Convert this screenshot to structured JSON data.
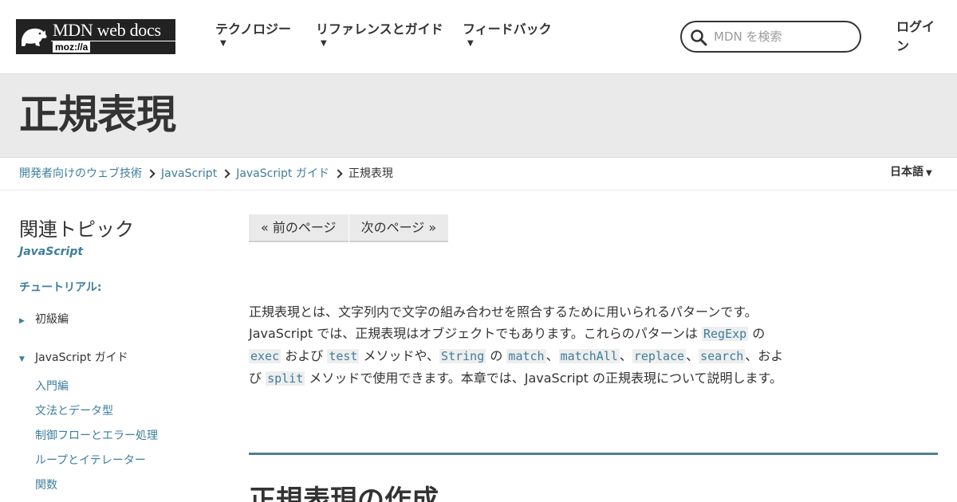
{
  "header": {
    "logo": {
      "title": "MDN web docs",
      "subtitle": "moz://a"
    },
    "nav": [
      {
        "label": "テクノロジー"
      },
      {
        "label": "リファレンスとガイド"
      },
      {
        "label": "フィードバック"
      }
    ],
    "search": {
      "placeholder": "MDN を検索",
      "value": ""
    },
    "login": "ログイン",
    "icons": {
      "logo": "mdn-dino-logo-icon",
      "search": "search-icon",
      "caret": "caret-down-icon"
    }
  },
  "page": {
    "title": "正規表現"
  },
  "breadcrumb": {
    "items": [
      {
        "label": "開発者向けのウェブ技術"
      },
      {
        "label": "JavaScript"
      },
      {
        "label": "JavaScript ガイド"
      }
    ],
    "current": "正規表現"
  },
  "language": {
    "label": "日本語"
  },
  "sidebar": {
    "heading": "関連トピック",
    "subheading": "JavaScript",
    "section": "チュートリアル:",
    "groups": [
      {
        "label": "初級編",
        "expanded": false
      },
      {
        "label": "JavaScript ガイド",
        "expanded": true
      }
    ],
    "links": [
      "入門編",
      "文法とデータ型",
      "制御フローとエラー処理",
      "ループとイテレーター",
      "関数"
    ]
  },
  "main": {
    "pager": {
      "prev": "« 前のページ",
      "next": "次のページ »"
    },
    "intro": {
      "t1": "正規表現とは、文字列内で文字の組み合わせを照合するために用いられるパターンです。JavaScript では、正規表現はオブジェクトでもあります。これらのパターンは ",
      "c1": "RegExp",
      "t2": " の ",
      "c2": "exec",
      "t3": " および ",
      "c3": "test",
      "t4": " メソッドや、",
      "c4": "String",
      "t5": " の ",
      "c5": "match",
      "t6": "、",
      "c6": "matchAll",
      "t7": "、",
      "c7": "replace",
      "t8": "、",
      "c8": "search",
      "t9": "、および ",
      "c9": "split",
      "t10": " メソッドで使用できます。本章では、JavaScript の正規表現について説明します。"
    },
    "section_heading": "正規表現の作成"
  },
  "colors": {
    "link": "#3d7e9a",
    "text": "#333333",
    "title_band": "#eaeaea",
    "divider": "#4d7f8e"
  }
}
